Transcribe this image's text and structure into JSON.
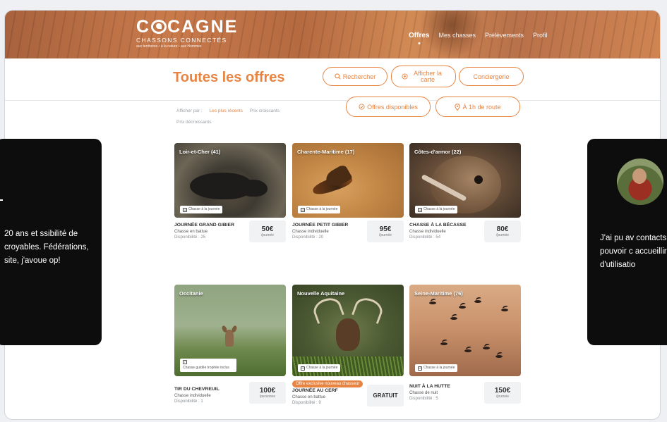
{
  "header": {
    "logo_title_left": "C",
    "logo_title_right": "CAGNE",
    "logo_subtitle": "CHASSONS CONNECTÉS",
    "logo_tagline": "aux territoires • à la nature • aux Hommes",
    "nav": [
      {
        "label": "Offres"
      },
      {
        "label": "Mes chasses"
      },
      {
        "label": "Prélèvements"
      },
      {
        "label": "Profil"
      }
    ]
  },
  "title_row": {
    "title": "Toutes les offres",
    "search_label": "Rechercher",
    "map_label": "Afficher la carte",
    "concierge_label": "Conciergerie"
  },
  "filters": {
    "sort_prefix": "Afficher par :",
    "sort_recent": "Les plus récents",
    "sort_asc": "Prix croissants",
    "sort_desc": "Prix décroissants",
    "available_label": "Offres disponibles",
    "route_label": "À 1h de route"
  },
  "cards": [
    {
      "region": "Loir-et-Cher (41)",
      "type": "Chasse à la journée",
      "name": "JOURNÉE GRAND GIBIER",
      "kind": "Chasse en battue",
      "avail": "Disponibilité : 25",
      "price": "50€",
      "unit": "/journée"
    },
    {
      "region": "Charente-Maritime (17)",
      "type": "Chasse à la journée",
      "name": "JOURNÉE PETIT GIBIER",
      "kind": "Chasse individuelle",
      "avail": "Disponibilité : 20",
      "price": "95€",
      "unit": "/journée"
    },
    {
      "region": "Côtes-d'armor (22)",
      "type": "Chasse à la journée",
      "name": "CHASSE À LA BÉCASSE",
      "kind": "Chasse individuelle",
      "avail": "Disponibilité : 54",
      "price": "80€",
      "unit": "/journée"
    },
    {
      "region": "Occitanie",
      "type": "Chasse guidée trophée inclus",
      "name": "TIR DU CHEVREUIL",
      "kind": "Chasse individuelle",
      "avail": "Disponibilité : 1",
      "price": "100€",
      "unit": "/personne"
    },
    {
      "region": "Nouvelle Aquitaine",
      "type": "Chasse à la journée",
      "name": "JOURNÉE AU CERF",
      "kind": "Chasse en battue",
      "avail": "Disponibilité : 9",
      "price": "GRATUIT",
      "unit": "",
      "badge": "Offre exclusive nouveau chasseur"
    },
    {
      "region": "Seine-Maritime (76)",
      "type": "Chasse à la journée",
      "name": "NUIT À LA HUTTE",
      "kind": "Chasse de nuit",
      "avail": "Disponibilité : 5",
      "price": "150€",
      "unit": "/journée"
    }
  ],
  "testimonials": {
    "left_quote": "20 ans et ssibilité de croyables. Fédérations, site, j'avoue op!",
    "right_quote": "J'ai pu av contacts pouvoir c accueillir. d'utilisatio"
  }
}
